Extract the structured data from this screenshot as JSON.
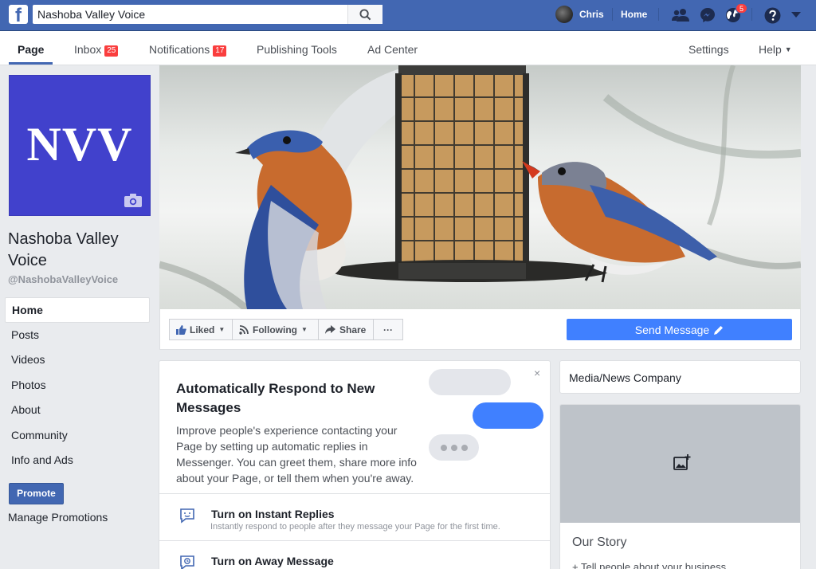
{
  "topbar": {
    "logo": "f",
    "search_value": "Nashoba Valley Voice",
    "user_name": "Chris",
    "home_label": "Home",
    "globe_badge": "5",
    "icons": [
      "search-icon",
      "friend-requests-icon",
      "messenger-icon",
      "globe-icon",
      "help-icon",
      "caret-down-icon"
    ]
  },
  "pagenav": {
    "page": "Page",
    "inbox": "Inbox",
    "inbox_count": "25",
    "notifications": "Notifications",
    "notifications_count": "17",
    "publishing_tools": "Publishing Tools",
    "ad_center": "Ad Center",
    "settings": "Settings",
    "help": "Help"
  },
  "profile": {
    "initials": "NVV",
    "name_line1": "Nashoba Valley",
    "name_line2": "Voice",
    "handle": "@NashobaValleyVoice",
    "brand_color": "#4141cc"
  },
  "leftnav": {
    "items": [
      "Home",
      "Posts",
      "Videos",
      "Photos",
      "About",
      "Community",
      "Info and Ads"
    ],
    "active": "Home",
    "promote": "Promote",
    "manage_promotions": "Manage Promotions"
  },
  "actions": {
    "liked": "Liked",
    "following": "Following",
    "share": "Share",
    "more": "···",
    "send_message": "Send Message"
  },
  "autorespond": {
    "title": "Automatically Respond to New Messages",
    "body": "Improve people's experience contacting your Page by setting up automatic replies in Messenger. You can greet them, share more info about your Page, or tell them when you're away.",
    "close": "×",
    "rows": [
      {
        "title": "Turn on Instant Replies",
        "subtitle": "Instantly respond to people after they message your Page for the first time."
      },
      {
        "title": "Turn on Away Message",
        "subtitle": ""
      }
    ]
  },
  "right": {
    "category": "Media/News Company",
    "story_heading": "Our Story",
    "story_link": "+ Tell people about your business"
  },
  "colors": {
    "fb_blue": "#4267b2",
    "send_blue": "#4080ff",
    "badge_red": "#fa3e3e"
  }
}
